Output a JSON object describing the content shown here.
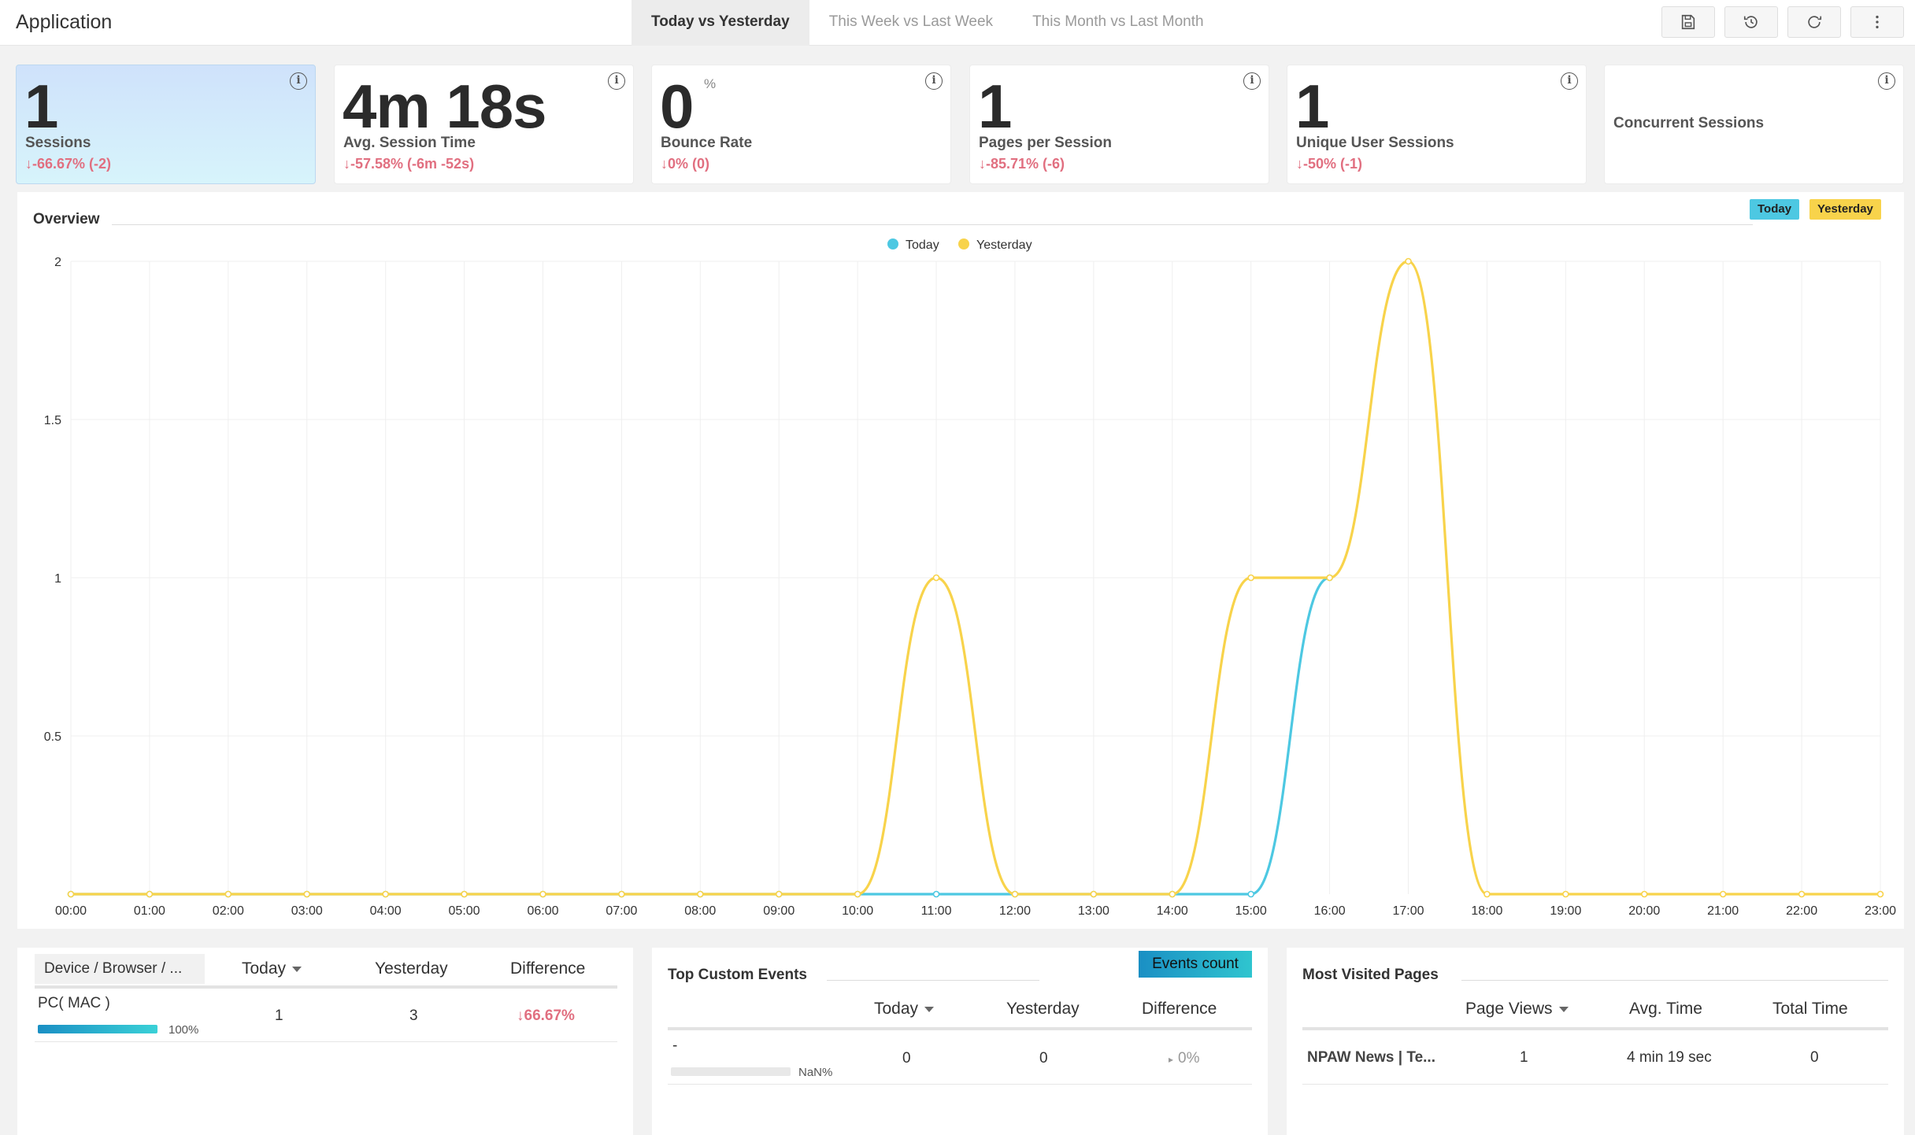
{
  "header": {
    "title": "Application",
    "tabs": [
      "Today vs Yesterday",
      "This Week vs Last Week",
      "This Month vs Last Month"
    ],
    "active_tab": 0,
    "actions": [
      "save-icon",
      "history-icon",
      "refresh-icon",
      "more-vertical-icon"
    ]
  },
  "kpis": [
    {
      "value": "1",
      "label": "Sessions",
      "delta": "-66.67% (-2)",
      "active": true
    },
    {
      "value": "4m 18s",
      "label": "Avg. Session Time",
      "delta": "-57.58% (-6m -52s)"
    },
    {
      "value": "0",
      "unit": "%",
      "label": "Bounce Rate",
      "delta": "0% (0)"
    },
    {
      "value": "1",
      "label": "Pages per Session",
      "delta": "-85.71% (-6)"
    },
    {
      "value": "1",
      "label": "Unique User Sessions",
      "delta": "-50% (-1)"
    },
    {
      "value": "",
      "label": "Concurrent Sessions",
      "delta": ""
    }
  ],
  "overview": {
    "title": "Overview",
    "badges": [
      {
        "label": "Today",
        "color": "#4dc8e2"
      },
      {
        "label": "Yesterday",
        "color": "#f8d34b"
      }
    ]
  },
  "chart_data": {
    "type": "line",
    "x": [
      "00:00",
      "01:00",
      "02:00",
      "03:00",
      "04:00",
      "05:00",
      "06:00",
      "07:00",
      "08:00",
      "09:00",
      "10:00",
      "11:00",
      "12:00",
      "13:00",
      "14:00",
      "15:00",
      "16:00",
      "17:00",
      "18:00",
      "19:00",
      "20:00",
      "21:00",
      "22:00",
      "23:00"
    ],
    "series": [
      {
        "name": "Today",
        "color": "#4dc8e2",
        "values": [
          0,
          0,
          0,
          0,
          0,
          0,
          0,
          0,
          0,
          0,
          0,
          0,
          0,
          0,
          0,
          0,
          1
        ]
      },
      {
        "name": "Yesterday",
        "color": "#f8d34b",
        "values": [
          0,
          0,
          0,
          0,
          0,
          0,
          0,
          0,
          0,
          0,
          0,
          1,
          0,
          0,
          0,
          1,
          1,
          2,
          0,
          0,
          0,
          0,
          0,
          0
        ]
      }
    ],
    "yticks": [
      "0.5",
      "1",
      "1.5",
      "2"
    ],
    "ylim": [
      0,
      2
    ],
    "legend_position": "top-center",
    "grid": true
  },
  "devices": {
    "headers": [
      "Device / Browser / ...",
      "Today",
      "Yesterday",
      "Difference"
    ],
    "rows": [
      {
        "name": "PC( MAC )",
        "share": "100%",
        "share_value": 1.0,
        "today": "1",
        "yesterday": "3",
        "difference": "66.67%"
      }
    ]
  },
  "custom_events": {
    "title": "Top Custom Events",
    "button": "Events count",
    "headers": [
      "Today",
      "Yesterday",
      "Difference"
    ],
    "rows": [
      {
        "name": "-",
        "share": "NaN%",
        "today": "0",
        "yesterday": "0",
        "difference": "0%"
      }
    ]
  },
  "most_visited": {
    "title": "Most Visited Pages",
    "headers": [
      "Page Views",
      "Avg. Time",
      "Total Time"
    ],
    "rows": [
      {
        "name": "NPAW News | Te...",
        "views": "1",
        "avg_time": "4 min 19 sec",
        "total_time": "0"
      }
    ]
  }
}
